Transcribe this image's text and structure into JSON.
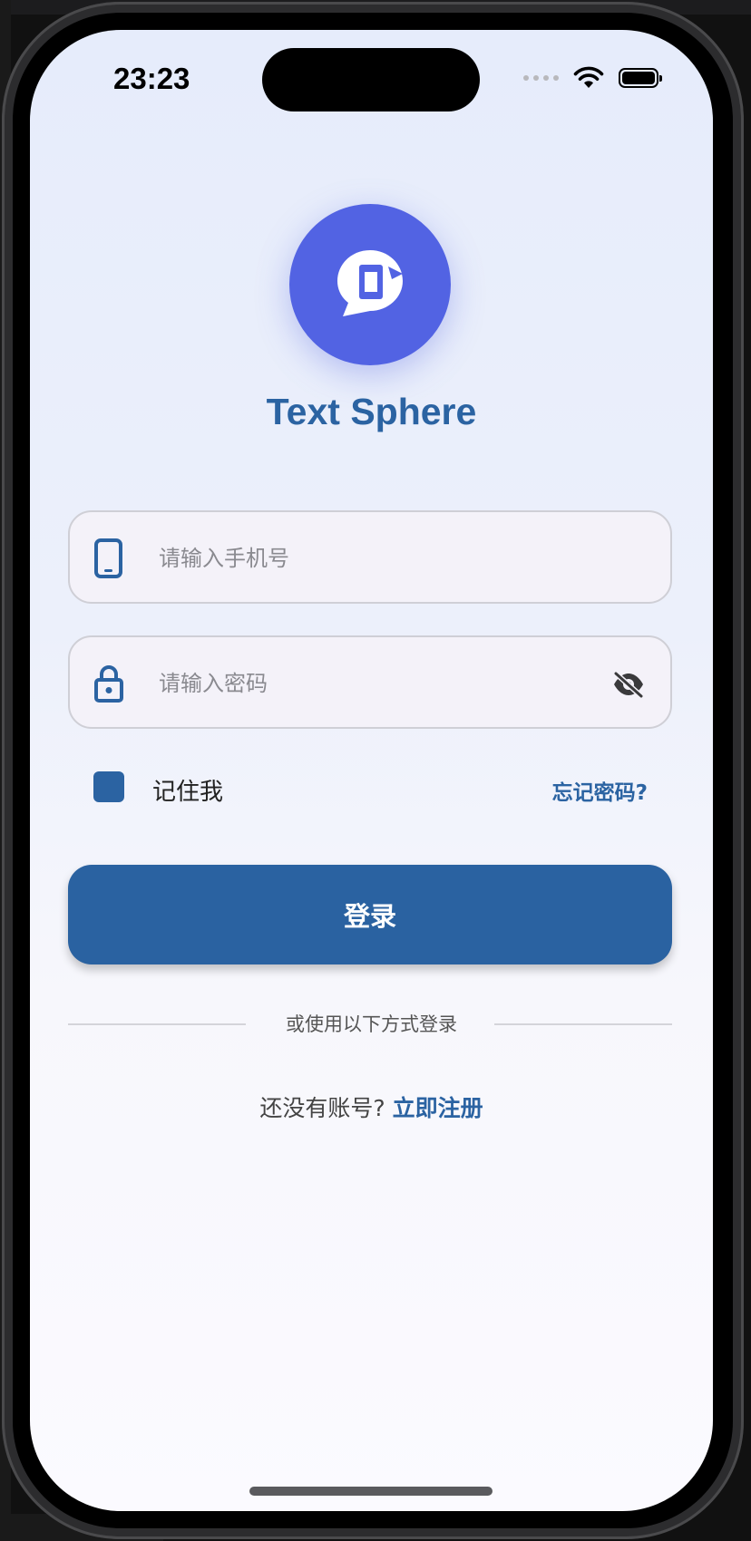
{
  "status_bar": {
    "time": "23:23"
  },
  "app": {
    "name": "Text Sphere",
    "logo_icon": "chat-bubble-phone-icon",
    "accent_color": "#2b63a2",
    "logo_color": "#5263e3"
  },
  "login_form": {
    "phone_placeholder": "请输入手机号",
    "phone_icon": "phone-icon",
    "password_placeholder": "请输入密码",
    "password_icon": "lock-icon",
    "visibility_icon": "eye-off-icon",
    "remember_label": "记住我",
    "remember_checked": true,
    "forgot_link": "忘记密码?",
    "login_button": "登录"
  },
  "alt_login": {
    "divider_text": "或使用以下方式登录"
  },
  "register": {
    "prompt": "还没有账号? ",
    "link": "立即注册"
  }
}
